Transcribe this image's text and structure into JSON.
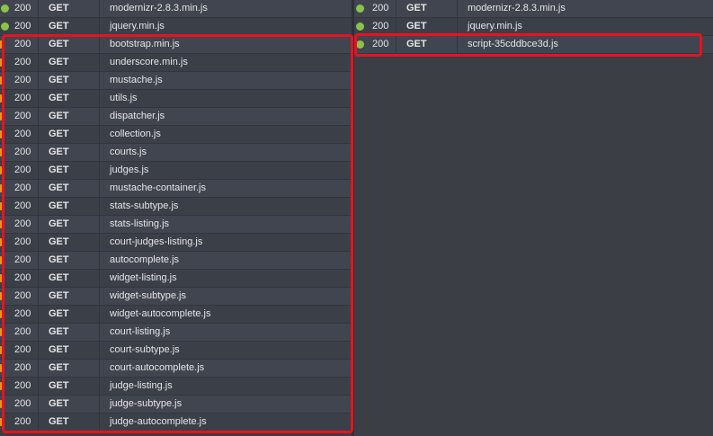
{
  "colors": {
    "ok": "#8bc34a",
    "pending": "#e8961f",
    "highlight": "#e8121f"
  },
  "left_requests": [
    {
      "status": "200",
      "method": "GET",
      "file": "modernizr-2.8.3.min.js",
      "state": "ok"
    },
    {
      "status": "200",
      "method": "GET",
      "file": "jquery.min.js",
      "state": "ok"
    },
    {
      "status": "200",
      "method": "GET",
      "file": "bootstrap.min.js",
      "state": "pending"
    },
    {
      "status": "200",
      "method": "GET",
      "file": "underscore.min.js",
      "state": "pending"
    },
    {
      "status": "200",
      "method": "GET",
      "file": "mustache.js",
      "state": "pending"
    },
    {
      "status": "200",
      "method": "GET",
      "file": "utils.js",
      "state": "pending"
    },
    {
      "status": "200",
      "method": "GET",
      "file": "dispatcher.js",
      "state": "pending"
    },
    {
      "status": "200",
      "method": "GET",
      "file": "collection.js",
      "state": "pending"
    },
    {
      "status": "200",
      "method": "GET",
      "file": "courts.js",
      "state": "pending"
    },
    {
      "status": "200",
      "method": "GET",
      "file": "judges.js",
      "state": "pending"
    },
    {
      "status": "200",
      "method": "GET",
      "file": "mustache-container.js",
      "state": "pending"
    },
    {
      "status": "200",
      "method": "GET",
      "file": "stats-subtype.js",
      "state": "pending"
    },
    {
      "status": "200",
      "method": "GET",
      "file": "stats-listing.js",
      "state": "pending"
    },
    {
      "status": "200",
      "method": "GET",
      "file": "court-judges-listing.js",
      "state": "pending"
    },
    {
      "status": "200",
      "method": "GET",
      "file": "autocomplete.js",
      "state": "pending"
    },
    {
      "status": "200",
      "method": "GET",
      "file": "widget-listing.js",
      "state": "pending"
    },
    {
      "status": "200",
      "method": "GET",
      "file": "widget-subtype.js",
      "state": "pending"
    },
    {
      "status": "200",
      "method": "GET",
      "file": "widget-autocomplete.js",
      "state": "pending"
    },
    {
      "status": "200",
      "method": "GET",
      "file": "court-listing.js",
      "state": "pending"
    },
    {
      "status": "200",
      "method": "GET",
      "file": "court-subtype.js",
      "state": "pending"
    },
    {
      "status": "200",
      "method": "GET",
      "file": "court-autocomplete.js",
      "state": "pending"
    },
    {
      "status": "200",
      "method": "GET",
      "file": "judge-listing.js",
      "state": "pending"
    },
    {
      "status": "200",
      "method": "GET",
      "file": "judge-subtype.js",
      "state": "pending"
    },
    {
      "status": "200",
      "method": "GET",
      "file": "judge-autocomplete.js",
      "state": "pending"
    }
  ],
  "right_requests": [
    {
      "status": "200",
      "method": "GET",
      "file": "modernizr-2.8.3.min.js",
      "state": "ok"
    },
    {
      "status": "200",
      "method": "GET",
      "file": "jquery.min.js",
      "state": "ok"
    },
    {
      "status": "200",
      "method": "GET",
      "file": "script-35cddbce3d.js",
      "state": "ok"
    }
  ]
}
